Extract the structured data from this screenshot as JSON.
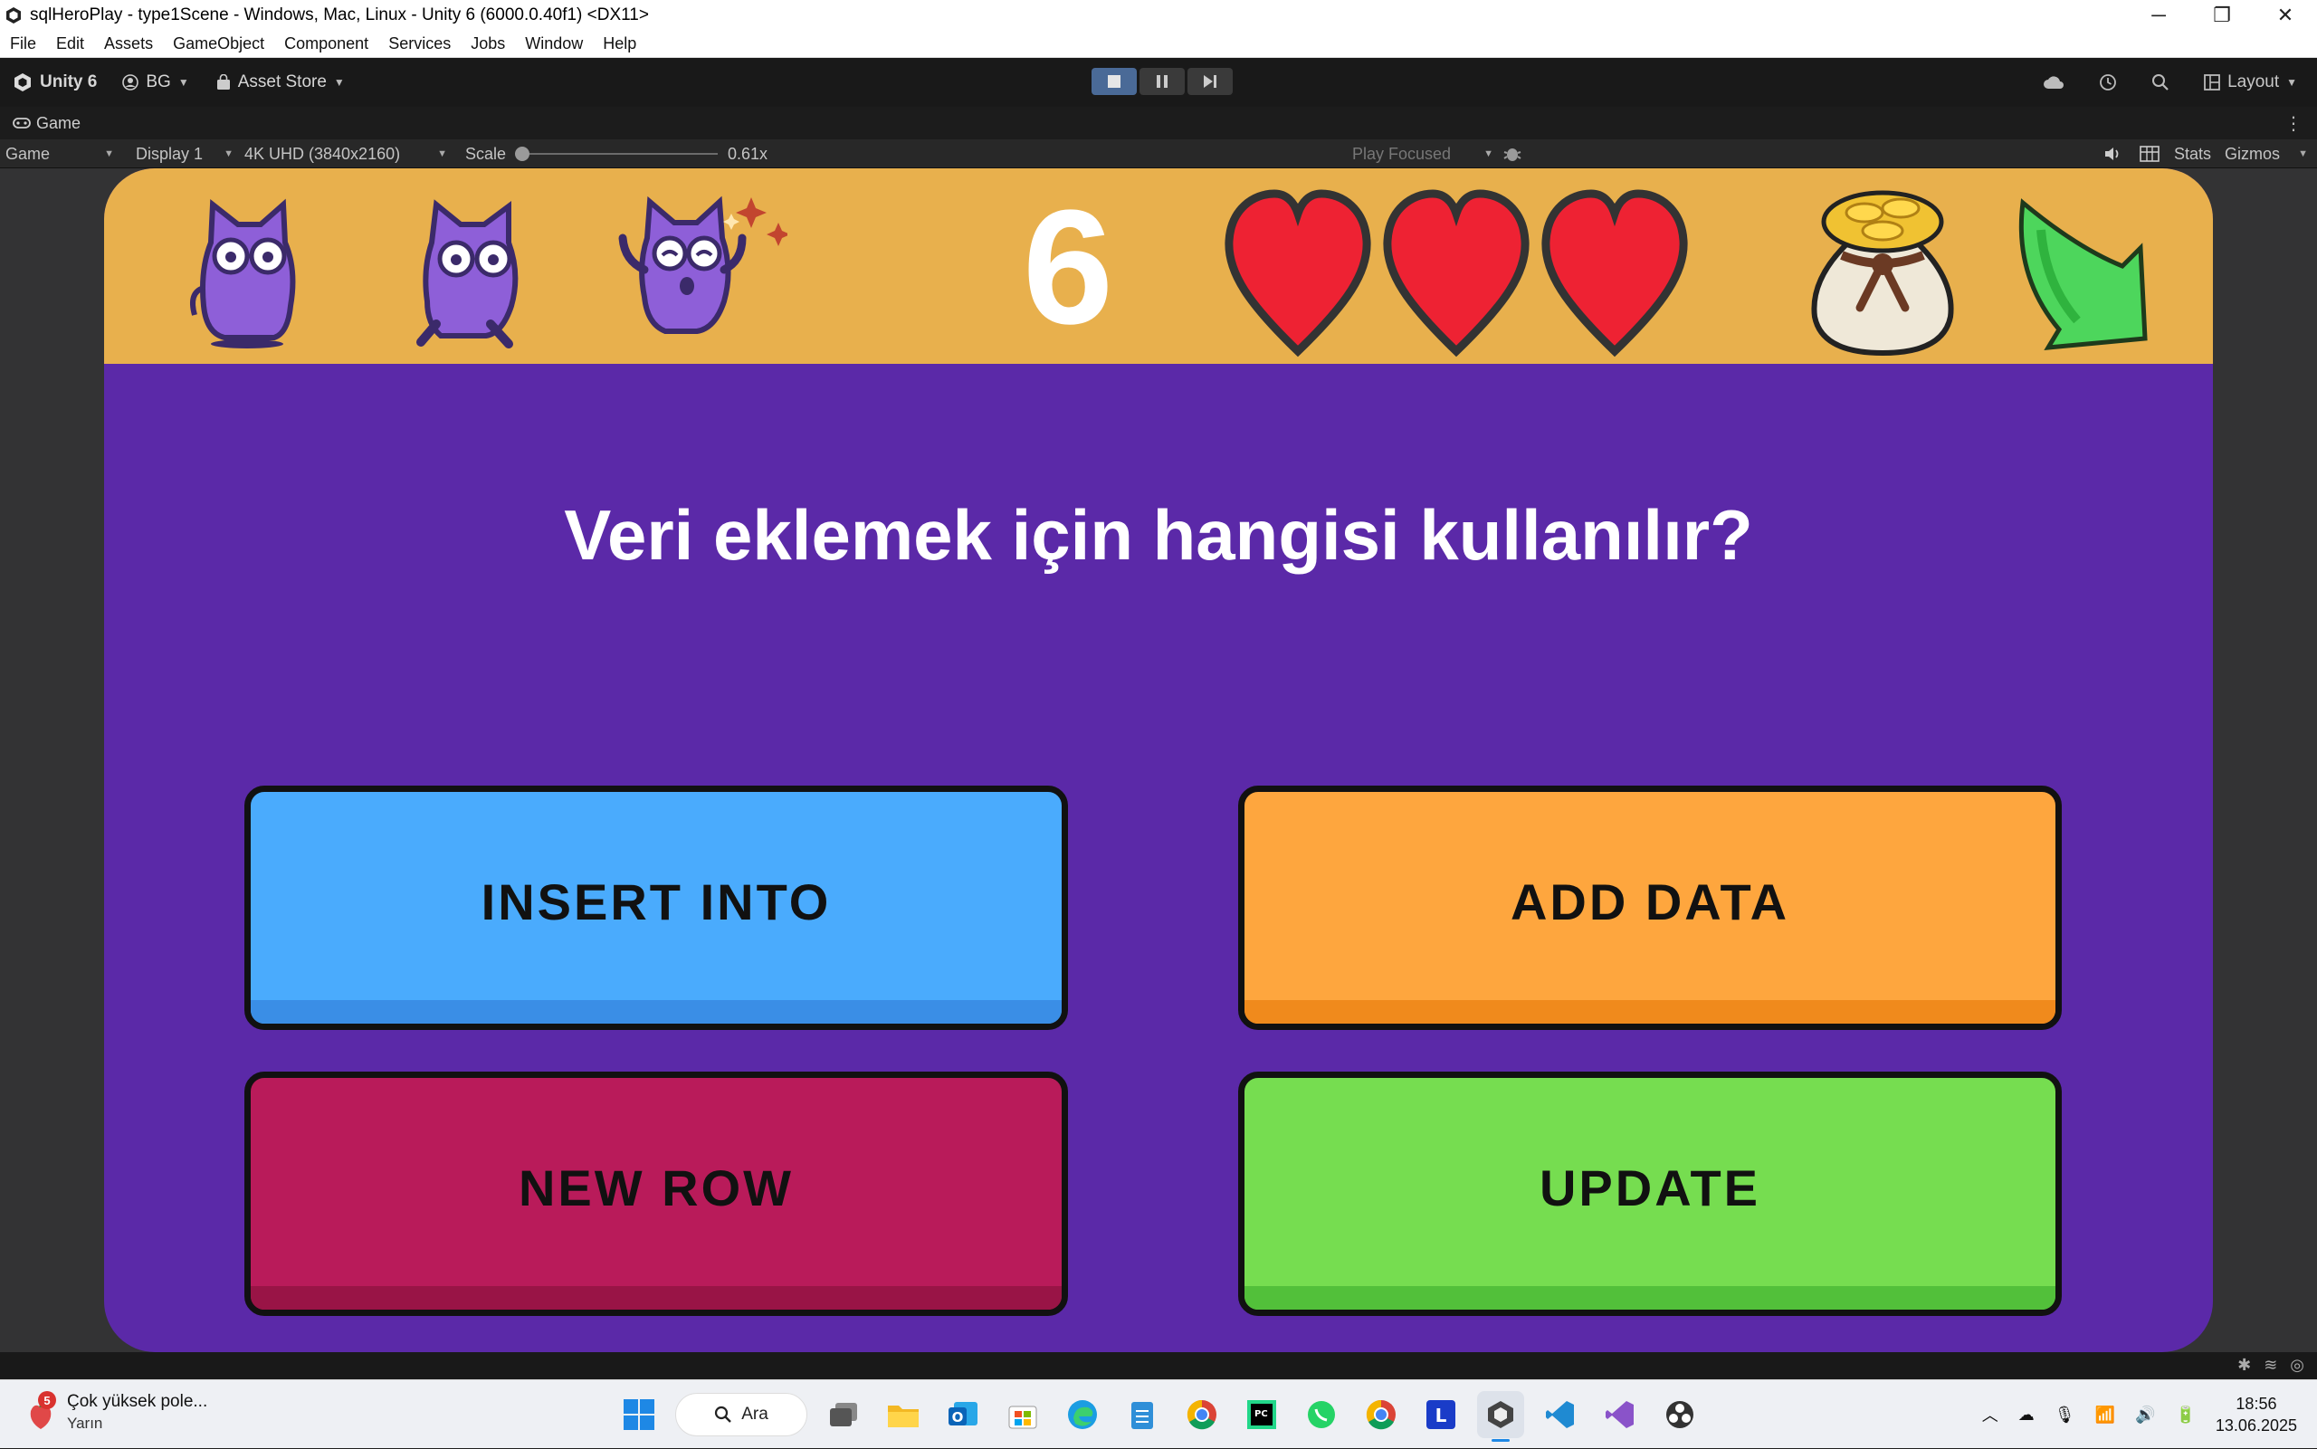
{
  "window": {
    "title": "sqlHeroPlay - type1Scene - Windows, Mac, Linux - Unity 6 (6000.0.40f1) <DX11>",
    "minimize": "─",
    "restore": "❐",
    "close": "✕"
  },
  "menu": [
    "File",
    "Edit",
    "Assets",
    "GameObject",
    "Component",
    "Services",
    "Jobs",
    "Window",
    "Help"
  ],
  "toolbar": {
    "unity_label": "Unity 6",
    "account_label": "BG",
    "asset_store_label": "Asset Store",
    "layout_label": "Layout"
  },
  "game_tab": {
    "label": "Game"
  },
  "game_bar": {
    "view_mode": "Game",
    "display": "Display 1",
    "resolution": "4K UHD (3840x2160)",
    "scale_label": "Scale",
    "scale_value": "0.61x",
    "play_mode": "Play Focused",
    "stats_label": "Stats",
    "gizmos_label": "Gizmos"
  },
  "game": {
    "score": "6",
    "lives": 3,
    "question": "Veri eklemek için hangisi kullanılır?",
    "answers": [
      {
        "label": "INSERT INTO",
        "color": "#4aabfd",
        "shade": "#3a8ee6"
      },
      {
        "label": "ADD DATA",
        "color": "#fea63e",
        "shade": "#f08a1c"
      },
      {
        "label": "NEW ROW",
        "color": "#b91b5a",
        "shade": "#991446"
      },
      {
        "label": "UPDATE",
        "color": "#76dd50",
        "shade": "#52c03a"
      }
    ]
  },
  "taskbar": {
    "notification_count": "5",
    "weather_text": "Çok yüksek pole...",
    "weather_sub": "Yarın",
    "search_label": "Ara",
    "time": "18:56",
    "date": "13.06.2025"
  },
  "colors": {
    "hud_bg": "#e8b04d",
    "game_bg": "#5b29a8",
    "heart": "#ee2233",
    "accent": "#4a6a97"
  }
}
